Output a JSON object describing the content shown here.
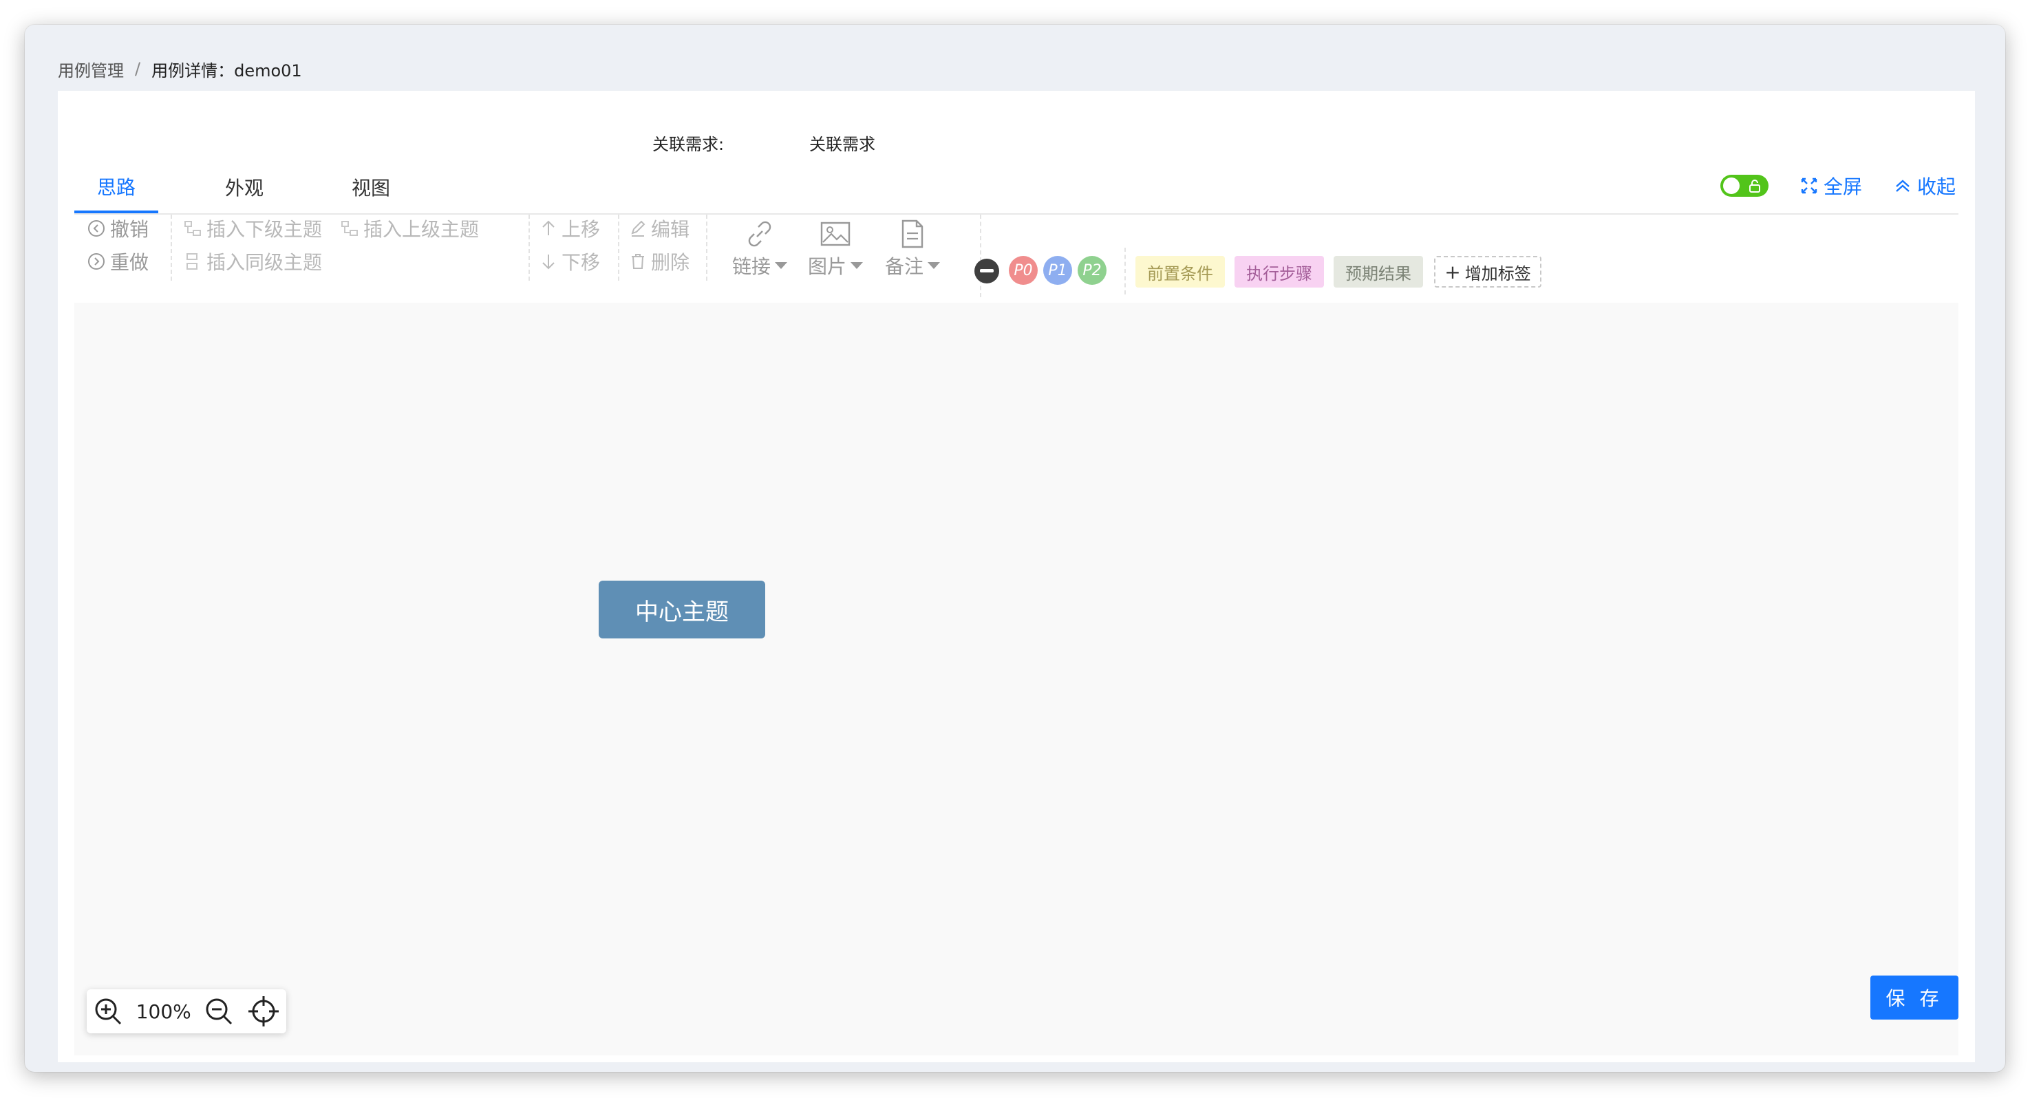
{
  "breadcrumb": {
    "parent": "用例管理",
    "separator": "/",
    "current": "用例详情：demo01"
  },
  "requirement": {
    "label": "关联需求:",
    "value": "关联需求"
  },
  "tabs": [
    {
      "label": "思路",
      "active": true
    },
    {
      "label": "外观"
    },
    {
      "label": "视图"
    }
  ],
  "top_actions": {
    "fullscreen": "全屏",
    "collapse": "收起"
  },
  "toolbar": {
    "undo": "撤销",
    "redo": "重做",
    "insert_child": "插入下级主题",
    "insert_parent": "插入上级主题",
    "insert_sibling": "插入同级主题",
    "move_up": "上移",
    "move_down": "下移",
    "edit": "编辑",
    "delete": "删除",
    "link": "链接",
    "image": "图片",
    "note": "备注"
  },
  "priorities": [
    {
      "label": "P0",
      "color": "#f08d8d"
    },
    {
      "label": "P1",
      "color": "#8eaef0"
    },
    {
      "label": "P2",
      "color": "#8fd18f"
    }
  ],
  "tags": [
    {
      "label": "前置条件",
      "bg": "#fdf8cf",
      "color": "#a59a55"
    },
    {
      "label": "执行步骤",
      "bg": "#f8d2f2",
      "color": "#a45e99"
    },
    {
      "label": "预期结果",
      "bg": "#e5e8e0",
      "color": "#7b8275"
    }
  ],
  "add_tag": "增加标签",
  "canvas": {
    "center_node": "中心主题"
  },
  "zoom": {
    "level": "100%"
  },
  "save_label": "保 存",
  "colors": {
    "primary": "#1677ff",
    "node": "#5f8fb5",
    "toggle": "#52c41a"
  }
}
